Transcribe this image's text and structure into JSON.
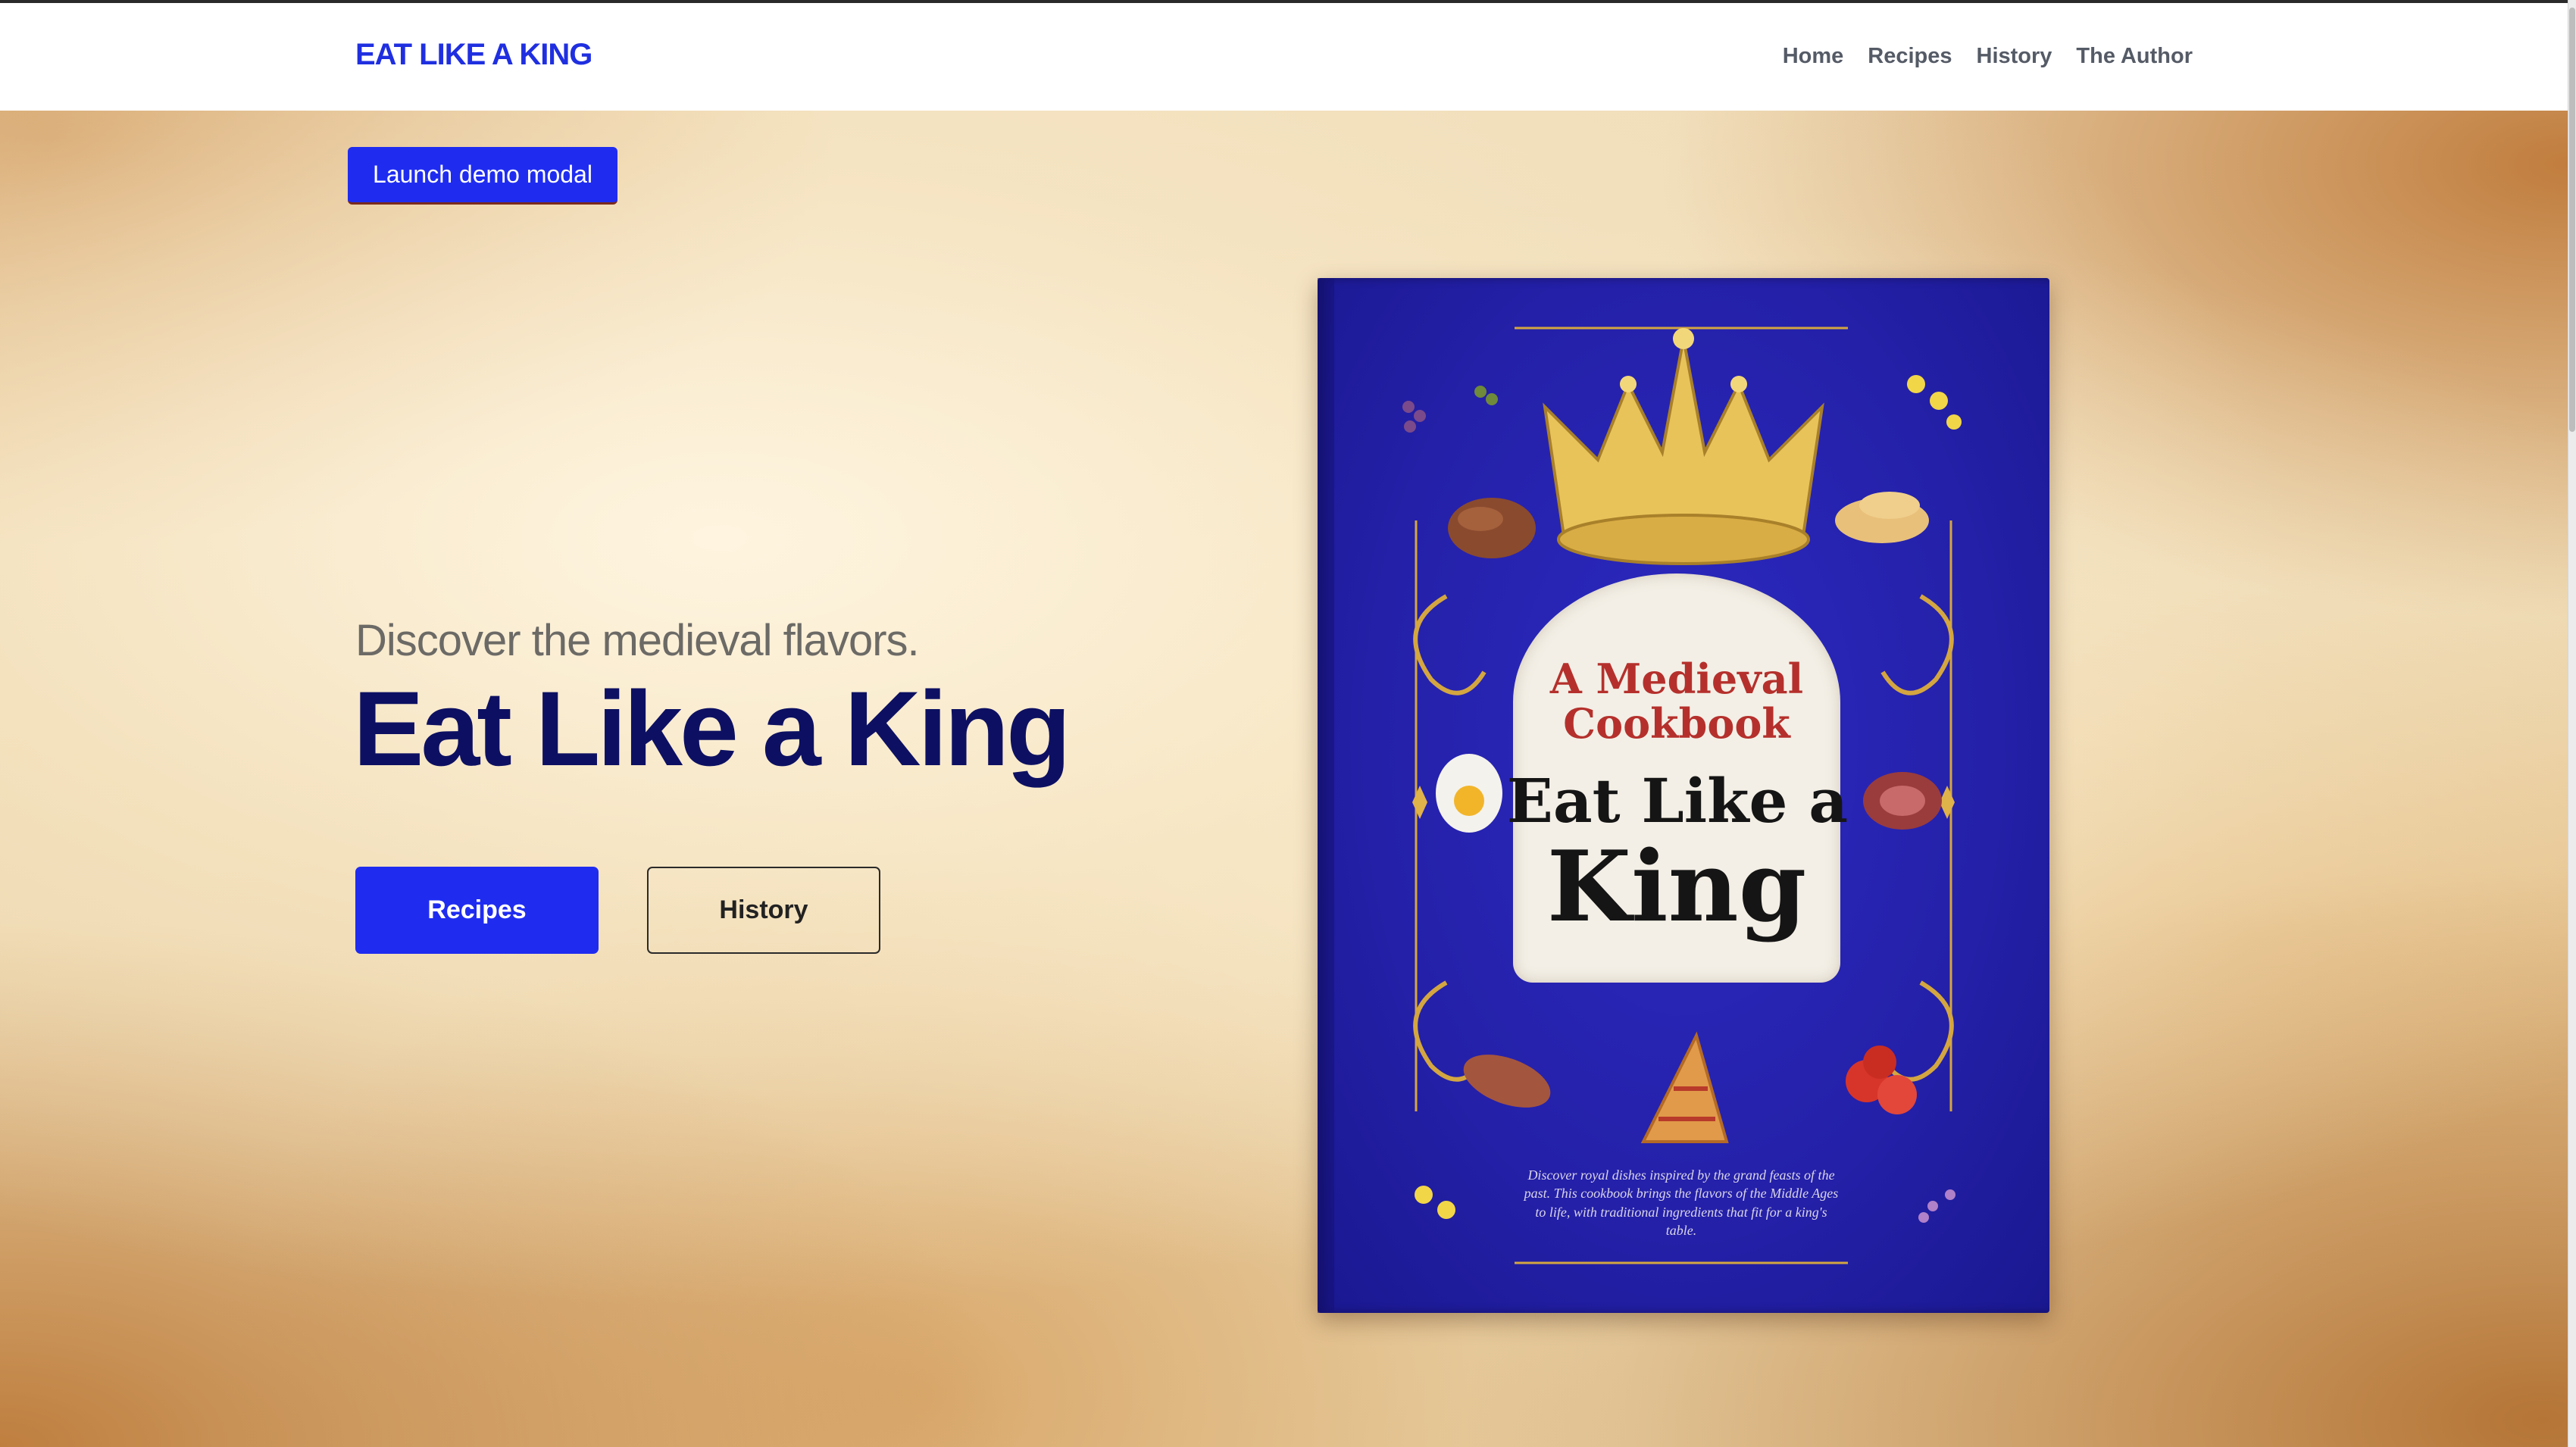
{
  "navbar": {
    "brand": "EAT LIKE A KING",
    "links": [
      "Home",
      "Recipes",
      "History",
      "The Author"
    ]
  },
  "hero": {
    "modal_button": "Launch demo modal",
    "subtitle": "Discover the medieval flavors.",
    "title": "Eat Like a King",
    "primary_button": "Recipes",
    "secondary_button": "History"
  },
  "book_cover": {
    "subtitle": "A Medieval Cookbook",
    "title_line1": "Eat Like a",
    "title_line2": "King",
    "blurb": "Discover royal dishes inspired by the grand feasts of the past. This cookbook brings the flavors of the Middle Ages to life, with traditional ingredients that fit for a king's table."
  },
  "colors": {
    "brand_blue": "#1f2cf0",
    "title_navy": "#0d1062",
    "cover_blue": "#2420a8",
    "cover_red": "#b5302c",
    "gold": "#d4a640"
  }
}
